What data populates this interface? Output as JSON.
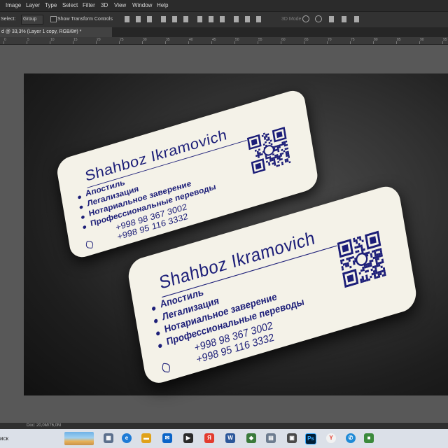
{
  "menu": [
    "Image",
    "Layer",
    "Type",
    "Select",
    "Filter",
    "3D",
    "View",
    "Window",
    "Help"
  ],
  "options": {
    "select_label": "Select:",
    "group_value": "Group",
    "transform_label": "Show Transform Controls",
    "mode_label": "3D Mode:"
  },
  "tab": {
    "title": "d @ 33,3% (Layer 1 copy, RGB/8#) *"
  },
  "ruler": [
    "0",
    "5",
    "10",
    "15",
    "20",
    "25",
    "30",
    "35",
    "40",
    "45",
    "50",
    "55",
    "60",
    "65",
    "70",
    "75",
    "80",
    "85",
    "90",
    "95"
  ],
  "status": {
    "doc": "Doc: 20,0M/76,0M"
  },
  "taskbar": {
    "search": "иск",
    "icons": [
      "mail-icon",
      "yandex-icon",
      "word-icon",
      "photoshop-icon",
      "yandex-browser-icon",
      "chat-icon"
    ]
  },
  "card": {
    "name": "Shahboz Ikramovich",
    "services": [
      "Апостиль",
      "Легализация",
      "Нотариальное заверение",
      "Профессиональные переводы"
    ],
    "phones": [
      "+998 98 367 3002",
      "+998 95 116 3332"
    ]
  },
  "colors": {
    "ink": "#1c1e78",
    "card": "#f4f2e8",
    "canvas": "#1e1e1e"
  }
}
